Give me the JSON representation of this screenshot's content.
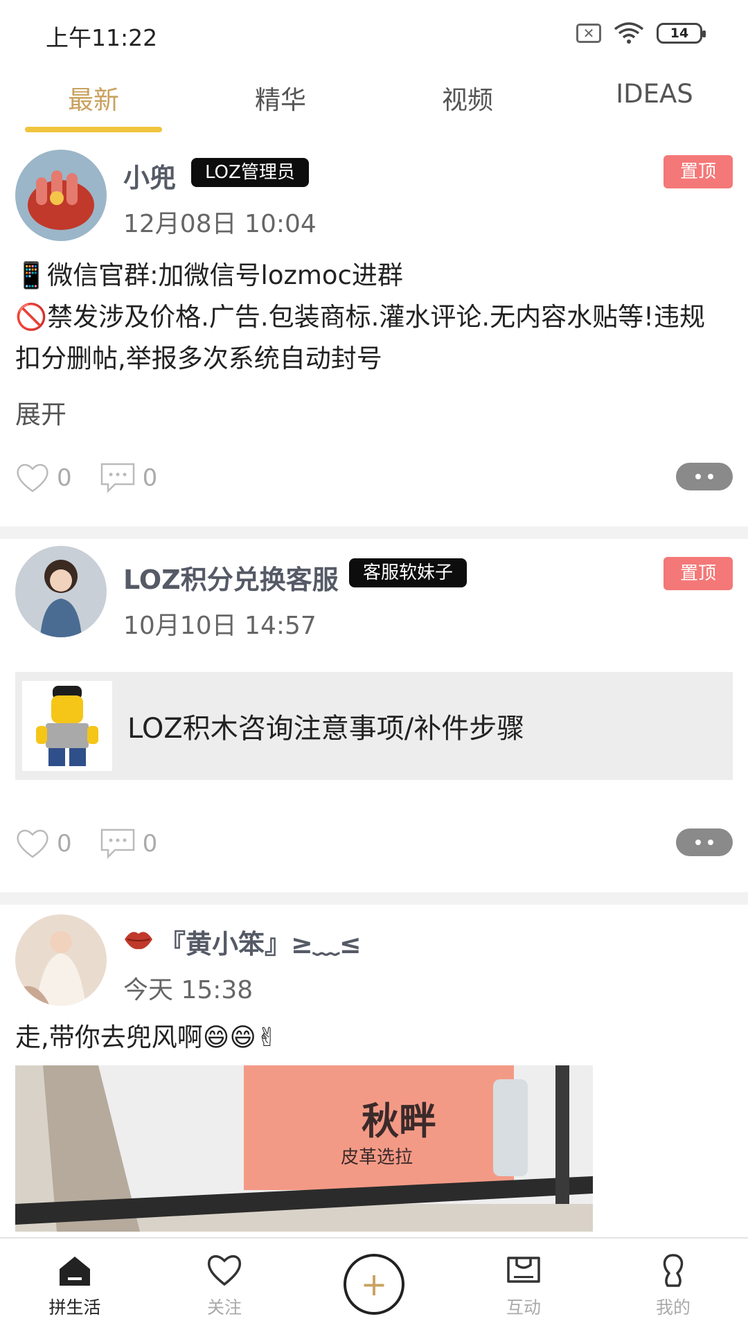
{
  "status_bar": {
    "time": "上午11:22",
    "battery": "14"
  },
  "tabs": [
    {
      "label": "最新",
      "active": true
    },
    {
      "label": "精华",
      "active": false
    },
    {
      "label": "视频",
      "active": false
    },
    {
      "label": "IDEAS",
      "active": false
    }
  ],
  "posts": [
    {
      "author": "小兜",
      "role": "LOZ管理员",
      "pinned": "置顶",
      "time": "12月08日 10:04",
      "lines": [
        "📱微信官群:加微信号lozmoc进群",
        "🚫禁发涉及价格.广告.包装商标.灌水评论.无内容水贴等!违规扣分删帖,举报多次系统自动封号"
      ],
      "expand": "展开",
      "likes": "0",
      "comments": "0"
    },
    {
      "author": "LOZ积分兑换客服",
      "role": "客服软妹子",
      "pinned": "置顶",
      "time": "10月10日 14:57",
      "link_title": "LOZ积木咨询注意事项/补件步骤",
      "likes": "0",
      "comments": "0"
    },
    {
      "author": "『黄小笨』≥﹏≤",
      "time": "今天 15:38",
      "text": "走,带你去兜风啊😄😄✌",
      "photo_text": "秋畔",
      "photo_subtext": "皮革选拉"
    }
  ],
  "bottom_nav": [
    {
      "label": "拼生活",
      "icon": "home-icon",
      "active": true
    },
    {
      "label": "关注",
      "icon": "heart-icon",
      "active": false
    },
    {
      "label": "",
      "icon": "add-icon",
      "active": false
    },
    {
      "label": "互动",
      "icon": "message-box-icon",
      "active": false
    },
    {
      "label": "我的",
      "icon": "profile-icon",
      "active": false
    }
  ],
  "colors": {
    "accent": "#c9a15f",
    "tab_underline": "#f1c43e",
    "pin": "#f47878"
  }
}
